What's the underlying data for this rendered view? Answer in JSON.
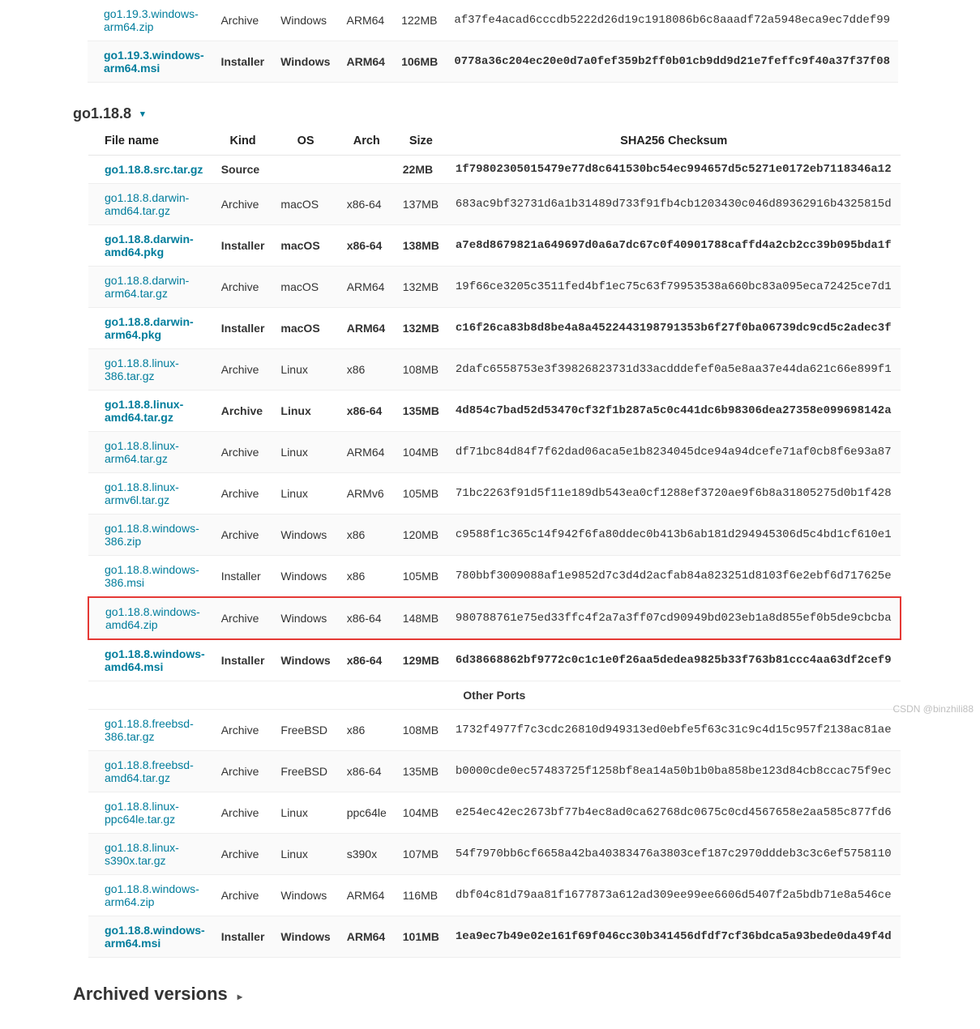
{
  "top_rows": [
    {
      "name": "go1.19.3.windows-arm64.zip",
      "kind": "Archive",
      "os": "Windows",
      "arch": "ARM64",
      "size": "122MB",
      "sha": "af37fe4acad6cccdb5222d26d19c1918086b6c8aaadf72a5948eca9ec7ddef99",
      "featured": false
    },
    {
      "name": "go1.19.3.windows-arm64.msi",
      "kind": "Installer",
      "os": "Windows",
      "arch": "ARM64",
      "size": "106MB",
      "sha": "0778a36c204ec20e0d7a0fef359b2ff0b01cb9dd9d21e7feffc9f40a37f37f08",
      "featured": true
    }
  ],
  "version_title": "go1.18.8",
  "headers": {
    "name": "File name",
    "kind": "Kind",
    "os": "OS",
    "arch": "Arch",
    "size": "Size",
    "sha": "SHA256 Checksum"
  },
  "other_ports_label": "Other Ports",
  "archived_label": "Archived versions",
  "watermark": "CSDN @binzhili88",
  "rows": [
    {
      "name": "go1.18.8.src.tar.gz",
      "kind": "Source",
      "os": "",
      "arch": "",
      "size": "22MB",
      "sha": "1f79802305015479e77d8c641530bc54ec994657d5c5271e0172eb7118346a12",
      "featured": true
    },
    {
      "name": "go1.18.8.darwin-amd64.tar.gz",
      "kind": "Archive",
      "os": "macOS",
      "arch": "x86-64",
      "size": "137MB",
      "sha": "683ac9bf32731d6a1b31489d733f91fb4cb1203430c046d89362916b4325815d",
      "featured": false
    },
    {
      "name": "go1.18.8.darwin-amd64.pkg",
      "kind": "Installer",
      "os": "macOS",
      "arch": "x86-64",
      "size": "138MB",
      "sha": "a7e8d8679821a649697d0a6a7dc67c0f40901788caffd4a2cb2cc39b095bda1f",
      "featured": true
    },
    {
      "name": "go1.18.8.darwin-arm64.tar.gz",
      "kind": "Archive",
      "os": "macOS",
      "arch": "ARM64",
      "size": "132MB",
      "sha": "19f66ce3205c3511fed4bf1ec75c63f79953538a660bc83a095eca72425ce7d1",
      "featured": false
    },
    {
      "name": "go1.18.8.darwin-arm64.pkg",
      "kind": "Installer",
      "os": "macOS",
      "arch": "ARM64",
      "size": "132MB",
      "sha": "c16f26ca83b8d8be4a8a4522443198791353b6f27f0ba06739dc9cd5c2adec3f",
      "featured": true
    },
    {
      "name": "go1.18.8.linux-386.tar.gz",
      "kind": "Archive",
      "os": "Linux",
      "arch": "x86",
      "size": "108MB",
      "sha": "2dafc6558753e3f39826823731d33acdddefef0a5e8aa37e44da621c66e899f1",
      "featured": false
    },
    {
      "name": "go1.18.8.linux-amd64.tar.gz",
      "kind": "Archive",
      "os": "Linux",
      "arch": "x86-64",
      "size": "135MB",
      "sha": "4d854c7bad52d53470cf32f1b287a5c0c441dc6b98306dea27358e099698142a",
      "featured": true
    },
    {
      "name": "go1.18.8.linux-arm64.tar.gz",
      "kind": "Archive",
      "os": "Linux",
      "arch": "ARM64",
      "size": "104MB",
      "sha": "df71bc84d84f7f62dad06aca5e1b8234045dce94a94dcefe71af0cb8f6e93a87",
      "featured": false
    },
    {
      "name": "go1.18.8.linux-armv6l.tar.gz",
      "kind": "Archive",
      "os": "Linux",
      "arch": "ARMv6",
      "size": "105MB",
      "sha": "71bc2263f91d5f11e189db543ea0cf1288ef3720ae9f6b8a31805275d0b1f428",
      "featured": false
    },
    {
      "name": "go1.18.8.windows-386.zip",
      "kind": "Archive",
      "os": "Windows",
      "arch": "x86",
      "size": "120MB",
      "sha": "c9588f1c365c14f942f6fa80ddec0b413b6ab181d294945306d5c4bd1cf610e1",
      "featured": false
    },
    {
      "name": "go1.18.8.windows-386.msi",
      "kind": "Installer",
      "os": "Windows",
      "arch": "x86",
      "size": "105MB",
      "sha": "780bbf3009088af1e9852d7c3d4d2acfab84a823251d8103f6e2ebf6d717625e",
      "featured": false
    },
    {
      "name": "go1.18.8.windows-amd64.zip",
      "kind": "Archive",
      "os": "Windows",
      "arch": "x86-64",
      "size": "148MB",
      "sha": "980788761e75ed33ffc4f2a7a3ff07cd90949bd023eb1a8d855ef0b5de9cbcba",
      "featured": false,
      "highlight": true
    },
    {
      "name": "go1.18.8.windows-amd64.msi",
      "kind": "Installer",
      "os": "Windows",
      "arch": "x86-64",
      "size": "129MB",
      "sha": "6d38668862bf9772c0c1c1e0f26aa5dedea9825b33f763b81ccc4aa63df2cef9",
      "featured": true
    }
  ],
  "other_ports": [
    {
      "name": "go1.18.8.freebsd-386.tar.gz",
      "kind": "Archive",
      "os": "FreeBSD",
      "arch": "x86",
      "size": "108MB",
      "sha": "1732f4977f7c3cdc26810d949313ed0ebfe5f63c31c9c4d15c957f2138ac81ae",
      "featured": false
    },
    {
      "name": "go1.18.8.freebsd-amd64.tar.gz",
      "kind": "Archive",
      "os": "FreeBSD",
      "arch": "x86-64",
      "size": "135MB",
      "sha": "b0000cde0ec57483725f1258bf8ea14a50b1b0ba858be123d84cb8ccac75f9ec",
      "featured": false
    },
    {
      "name": "go1.18.8.linux-ppc64le.tar.gz",
      "kind": "Archive",
      "os": "Linux",
      "arch": "ppc64le",
      "size": "104MB",
      "sha": "e254ec42ec2673bf77b4ec8ad0ca62768dc0675c0cd4567658e2aa585c877fd6",
      "featured": false
    },
    {
      "name": "go1.18.8.linux-s390x.tar.gz",
      "kind": "Archive",
      "os": "Linux",
      "arch": "s390x",
      "size": "107MB",
      "sha": "54f7970bb6cf6658a42ba40383476a3803cef187c2970dddeb3c3c6ef5758110",
      "featured": false
    },
    {
      "name": "go1.18.8.windows-arm64.zip",
      "kind": "Archive",
      "os": "Windows",
      "arch": "ARM64",
      "size": "116MB",
      "sha": "dbf04c81d79aa81f1677873a612ad309ee99ee6606d5407f2a5bdb71e8a546ce",
      "featured": false
    },
    {
      "name": "go1.18.8.windows-arm64.msi",
      "kind": "Installer",
      "os": "Windows",
      "arch": "ARM64",
      "size": "101MB",
      "sha": "1ea9ec7b49e02e161f69f046cc30b341456dfdf7cf36bdca5a93bede0da49f4d",
      "featured": true
    }
  ]
}
